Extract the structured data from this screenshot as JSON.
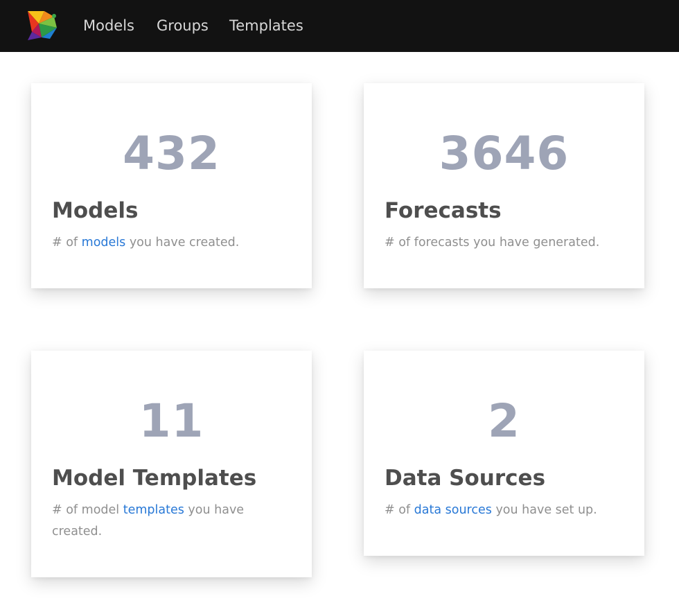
{
  "nav": {
    "logo_name": "app-logo",
    "items": [
      {
        "label": "Models"
      },
      {
        "label": "Groups"
      },
      {
        "label": "Templates"
      }
    ]
  },
  "cards": [
    {
      "value": "432",
      "title": "Models",
      "desc_prefix": "# of ",
      "desc_link": "models",
      "desc_suffix": " you have created."
    },
    {
      "value": "3646",
      "title": "Forecasts",
      "desc_prefix": "# of forecasts you have generated.",
      "desc_link": "",
      "desc_suffix": ""
    },
    {
      "value": "11",
      "title": "Model Templates",
      "desc_prefix": "# of model ",
      "desc_link": "templates",
      "desc_suffix": " you have created."
    },
    {
      "value": "2",
      "title": "Data Sources",
      "desc_prefix": "# of ",
      "desc_link": "data sources",
      "desc_suffix": " you have set up."
    }
  ],
  "colors": {
    "navbar_bg": "#121212",
    "nav_text": "#d8d8d8",
    "stat": "#9ea4b6",
    "title": "#4e4e4e",
    "desc": "#8f8f8f",
    "link": "#2878d6"
  }
}
